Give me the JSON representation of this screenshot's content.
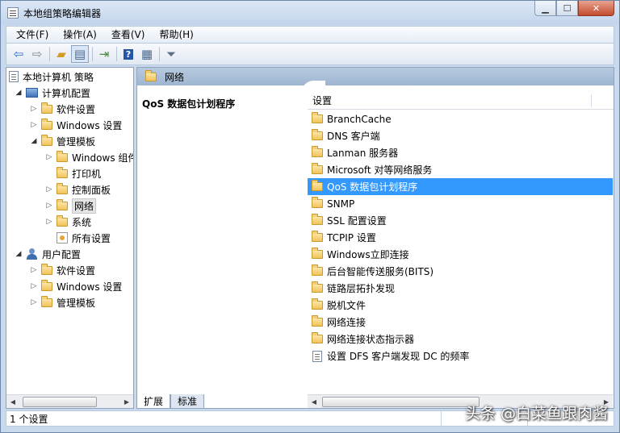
{
  "window": {
    "title": "本地组策略编辑器"
  },
  "menu": [
    "文件(F)",
    "操作(A)",
    "查看(V)",
    "帮助(H)"
  ],
  "toolbar": {
    "icons": [
      "back-icon",
      "forward-icon",
      "up-folder-icon",
      "show-hide-tree-icon",
      "export-list-icon",
      "help-icon",
      "properties-icon",
      "filter-icon"
    ]
  },
  "tree": {
    "root": "本地计算机 策略",
    "computer_config": "计算机配置",
    "cc_software": "软件设置",
    "cc_windows": "Windows 设置",
    "cc_admin": "管理模板",
    "at_windows": "Windows 组件",
    "at_printer": "打印机",
    "at_control": "控制面板",
    "at_network": "网络",
    "at_system": "系统",
    "at_all": "所有设置",
    "user_config": "用户配置",
    "uc_software": "软件设置",
    "uc_windows": "Windows 设置",
    "uc_admin": "管理模板"
  },
  "right": {
    "header": "网络",
    "desc_title": "QoS 数据包计划程序",
    "column": "设置",
    "items": [
      "BranchCache",
      "DNS 客户端",
      "Lanman 服务器",
      "Microsoft 对等网络服务",
      "QoS 数据包计划程序",
      "SNMP",
      "SSL 配置设置",
      "TCPIP 设置",
      "Windows立即连接",
      "后台智能传送服务(BITS)",
      "链路层拓扑发现",
      "脱机文件",
      "网络连接",
      "网络连接状态指示器",
      "设置 DFS 客户端发现 DC 的频率"
    ],
    "selected_index": 4
  },
  "tabs": [
    "扩展",
    "标准"
  ],
  "status": "1 个设置",
  "watermark": "头条 @白菜鱼跟肉酱"
}
